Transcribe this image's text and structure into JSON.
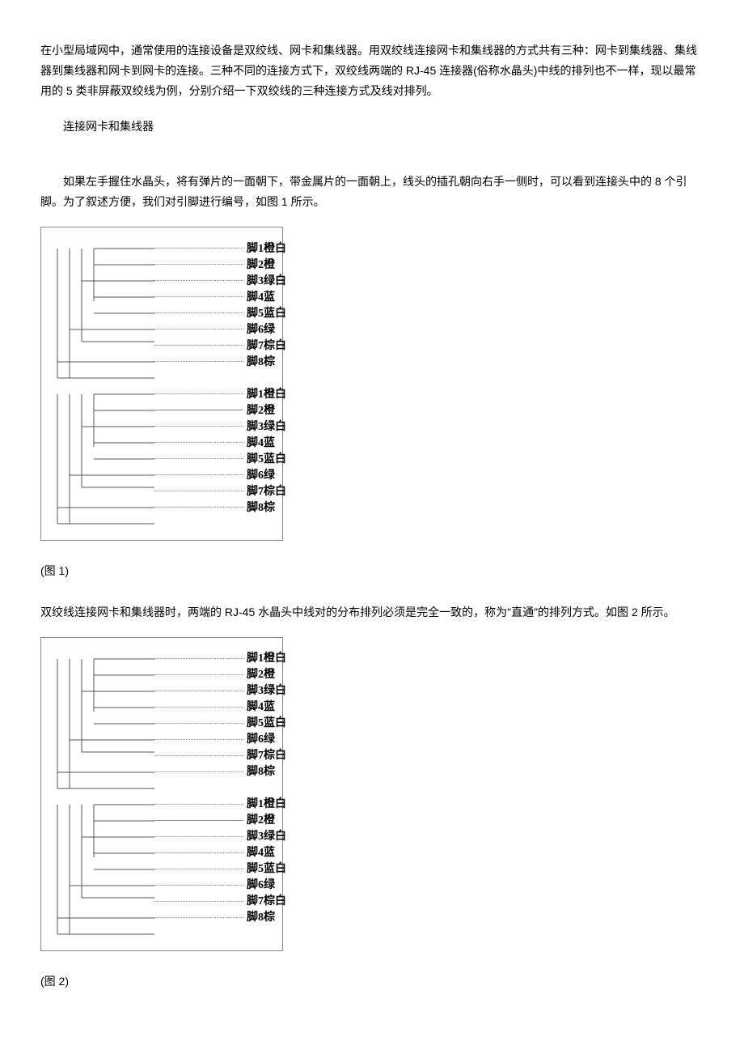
{
  "para1": "在小型局域网中，通常使用的连接设备是双绞线、网卡和集线器。用双绞线连接网卡和集线器的方式共有三种：网卡到集线器、集线器到集线器和网卡到网卡的连接。三种不同的连接方式下，双绞线两端的 RJ-45 连接器(俗称水晶头)中线的排列也不一样，现以最常用的 5 类非屏蔽双绞线为例，分别介绍一下双绞线的三种连接方式及线对排列。",
  "section_heading": "连接网卡和集线器",
  "para2": "如果左手握住水晶头，将有弹片的一面朝下，带金属片的一面朝上，线头的插孔朝向右手一侧时，可以看到连接头中的 8 个引脚。为了叙述方便，我们对引脚进行编号，如图 1 所示。",
  "figure1_caption": "(图 1)",
  "para3": "双绞线连接网卡和集线器时，两端的 RJ-45 水晶头中线对的分布排列必须是完全一致的，称为\"直通\"的排列方式。如图 2 所示。",
  "figure2_caption": "(图 2)",
  "pins": [
    "脚1橙白",
    "脚2橙",
    "脚3绿白",
    "脚4蓝",
    "脚5蓝白",
    "脚6绿",
    "脚7棕白",
    "脚8棕"
  ]
}
